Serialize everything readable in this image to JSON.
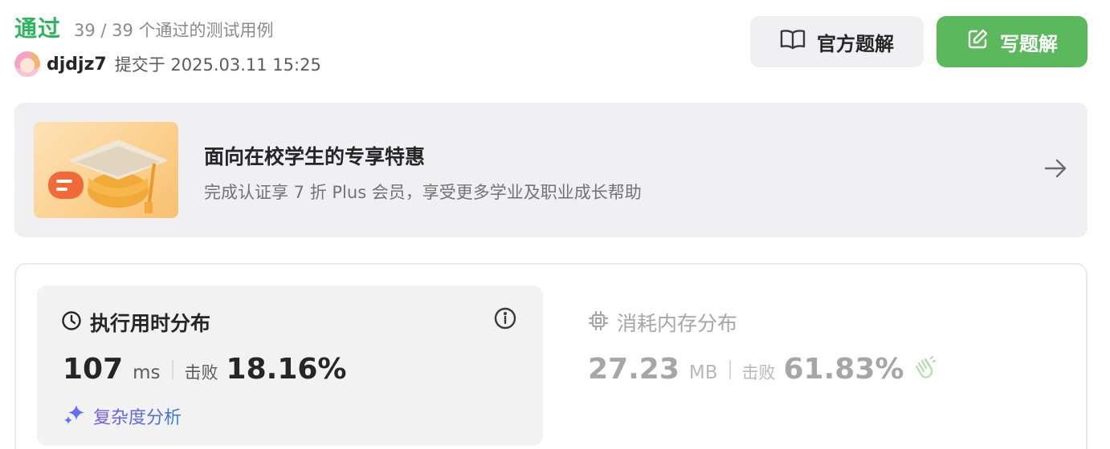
{
  "header": {
    "status": "通过",
    "testcases": "39 / 39 个通过的测试用例",
    "username": "djdjz7",
    "submitted_at": "提交于 2025.03.11 15:25",
    "solution_button": "官方题解",
    "write_button": "写题解"
  },
  "promo": {
    "title": "面向在校学生的专享特惠",
    "subtitle": "完成认证享 7 折 Plus 会员，享受更多学业及职业成长帮助"
  },
  "runtime": {
    "title": "执行用时分布",
    "value": "107",
    "unit": "ms",
    "beats_label": "击败",
    "beats": "18.16%",
    "complexity_link": "复杂度分析"
  },
  "memory": {
    "title": "消耗内存分布",
    "value": "27.23",
    "unit": "MB",
    "beats_label": "击败",
    "beats": "61.83%"
  },
  "icons": [
    "book-icon",
    "edit-icon",
    "arrow-right-icon",
    "clock-icon",
    "info-icon",
    "sparkle-icon",
    "chip-icon",
    "clap-icon"
  ],
  "colors": {
    "accent_green": "#2db55d",
    "button_green": "#5cb85c",
    "panel_bg": "#f2f2f3"
  }
}
